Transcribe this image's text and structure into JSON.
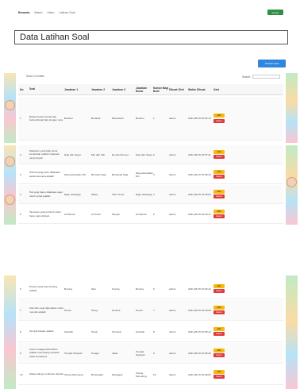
{
  "nav": {
    "links": [
      "Beranda",
      "Materi",
      "Video",
      "Latihan Soal"
    ],
    "logout": "Keluar"
  },
  "page": {
    "title": "Data Latihan Soal",
    "add_button": "Tambah Data"
  },
  "controls": {
    "show_label": "Show",
    "entries_value": "10",
    "entries_label": "entries",
    "search_label": "Search:"
  },
  "table": {
    "headers": [
      "No",
      "Soal",
      "Jawaban 1",
      "Jawaban 2",
      "Jawaban 3",
      "Jawaban Benar",
      "Nomor Bagi Butir",
      "Dibuat Oleh",
      "Waktu Dibuat",
      "Aksi"
    ]
  },
  "rows_card1": [
    {
      "no": "1",
      "soal": "Bebek hewan ternak dan berkembang biak dengan cara",
      "j1": "Bertelur",
      "j2": "Beranak",
      "j3": "Membelah",
      "jw": "Bertelur",
      "nb": "1",
      "db": "admin",
      "dt": "2021-08-15 15:54:12"
    }
  ],
  "rows_card2": [
    {
      "no": "2",
      "soal": "Makanan yang baik untuk kesehatan adalah makanan yang bergizi",
      "j1": "Nasi dan Sayur",
      "j2": "Mie dan Ciki",
      "j3": "Es dan Permen",
      "jw": "Nasi dan Sayur",
      "nb": "2",
      "db": "admin",
      "dt": "2021-08-15 15:57:21"
    },
    {
      "no": "3",
      "soal": "Hal hal yang perlu dilakukan ketika bencana adalah",
      "j1": "Menyelamatkan Diri",
      "j2": "Bermain Saja",
      "j3": "Bersantai Saja",
      "jw": "Menyelamatkan Diri",
      "nb": "3",
      "db": "admin",
      "dt": "2021-08-15 15:58:10"
    },
    {
      "no": "4",
      "soal": "Hal yang harus dilakukan agar tubuh sehat adalah",
      "j1": "Rajin Olahraga",
      "j2": "Malas",
      "j3": "Tidur Terus",
      "jw": "Rajin Olahraga",
      "nb": "4",
      "db": "admin",
      "dt": "2021-08-15 15:59:03"
    },
    {
      "no": "5",
      "soal": "Tanaman yang tumbuh subur harus rajin disiram",
      "j1": "Air Bersih",
      "j2": "Air Kotor",
      "j3": "Minyak",
      "jw": "Air Bersih",
      "nb": "5",
      "db": "admin",
      "dt": "2021-08-15 16:00:11"
    }
  ],
  "rows_card3": [
    {
      "no": "6",
      "soal": "Hewan yang bisa terbang adalah",
      "j1": "Burung",
      "j2": "Ikan",
      "j3": "Kucing",
      "jw": "Burung",
      "nb": "6",
      "db": "admin",
      "dt": "2021-08-15 16:02:44"
    },
    {
      "no": "7",
      "soal": "Alat tulis yang digunakan untuk menulis adalah",
      "j1": "Pensil",
      "j2": "Piring",
      "j3": "Sendok",
      "jw": "Pensil",
      "nb": "7",
      "db": "admin",
      "dt": "2021-08-15 16:03:50"
    },
    {
      "no": "8",
      "soal": "Tempat belajar adalah",
      "j1": "Sekolah",
      "j2": "Pasar",
      "j3": "Terminal",
      "jw": "Sekolah",
      "nb": "8",
      "db": "admin",
      "dt": "2021-08-15 16:05:12"
    },
    {
      "no": "9",
      "soal": "Cara menjaga kebersihan adalah membuang sampah pada tempatnya",
      "j1": "Tempat Sampah",
      "j2": "Sungai",
      "j3": "Jalan",
      "jw": "Tempat Sampah",
      "nb": "9",
      "db": "admin",
      "dt": "2021-08-15 16:06:30"
    },
    {
      "no": "10",
      "soal": "Sikap saling membantu disebut",
      "j1": "Tolong Menolong",
      "j2": "Bertengkar",
      "j3": "Mengejek",
      "jw": "Tolong Menolong",
      "nb": "10",
      "db": "admin",
      "dt": "2021-08-15 16:08:02"
    }
  ],
  "actions": {
    "edit": "Edit",
    "delete": "Hapus"
  },
  "colors": {
    "nav_bg": "#ffffff",
    "logout": "#2f8f46",
    "add": "#2e86de",
    "edit": "#f6b90f",
    "delete": "#e03a3a"
  }
}
